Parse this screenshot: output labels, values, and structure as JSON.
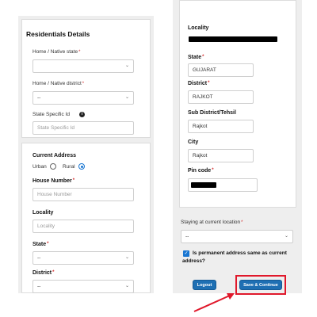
{
  "left": {
    "section_title": "Residentials Details",
    "home_state_label": "Home / Native state",
    "home_district_label": "Home / Native district",
    "home_district_value": "--",
    "state_specific_id_label": "State Specific Id",
    "state_specific_id_placeholder": "State Specific Id",
    "current_address_title": "Current Address",
    "urban_label": "Urban",
    "rural_label": "Rural",
    "selected_area": "Rural",
    "house_number_label": "House Number",
    "house_number_placeholder": "House Number",
    "locality_label": "Locality",
    "locality_placeholder": "Locality",
    "state_label": "State",
    "state_value": "--",
    "district_label": "District",
    "district_value": "--"
  },
  "right": {
    "locality_label": "Locality",
    "state_label": "State",
    "state_value": "GUJARAT",
    "district_label": "District",
    "district_value": "RAJKOT",
    "subdistrict_label": "Sub District/Tehsil",
    "subdistrict_value": "Rajkot",
    "city_label": "City",
    "city_value": "Rajkot",
    "pincode_label": "Pin code",
    "staying_label": "Staying at current location",
    "staying_value": "--",
    "permanent_same_label_line1": "Is permanent address same as current",
    "permanent_same_label_line2": "address?",
    "permanent_same_checked": true,
    "logout_label": "Logout",
    "save_label": "Save & Continue"
  },
  "symbols": {
    "required": "*",
    "chevron": "⌄",
    "info": "i",
    "check": "✓"
  },
  "colors": {
    "primary_button": "#1e6fb3",
    "highlight": "#e0182b",
    "required_star": "#d32f2f",
    "redaction": "#000000"
  }
}
